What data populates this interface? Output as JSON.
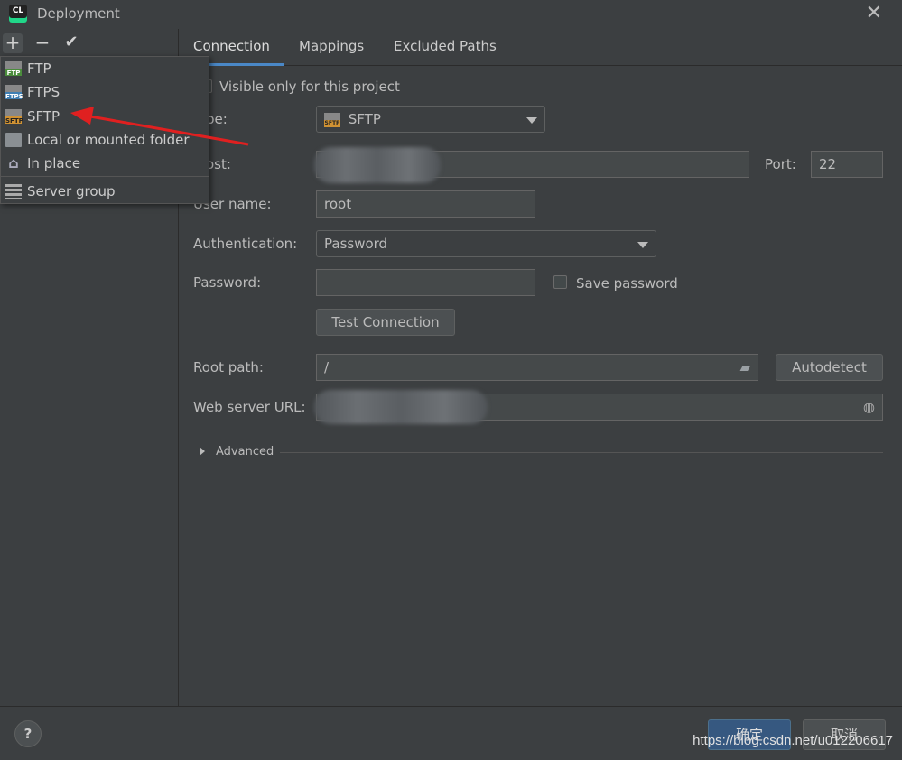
{
  "window": {
    "title": "Deployment",
    "logo_text": "CL"
  },
  "left_toolbar": {
    "add": "+",
    "remove": "−",
    "apply": "✔"
  },
  "add_popup": {
    "items": [
      {
        "label": "FTP",
        "icon": "ftp-icon",
        "icon_text": "FTP"
      },
      {
        "label": "FTPS",
        "icon": "ftps-icon",
        "icon_text": "FTPS"
      },
      {
        "label": "SFTP",
        "icon": "sftp-icon",
        "icon_text": "SFTP"
      },
      {
        "label": "Local or mounted folder",
        "icon": "folder-icon",
        "icon_text": ""
      },
      {
        "label": "In place",
        "icon": "home-icon",
        "icon_text": "⌂"
      },
      {
        "label": "Server group",
        "icon": "server-group-icon",
        "icon_text": ""
      }
    ]
  },
  "tabs": [
    {
      "label": "Connection",
      "active": true
    },
    {
      "label": "Mappings",
      "active": false
    },
    {
      "label": "Excluded Paths",
      "active": false
    }
  ],
  "form": {
    "visible_only_label": "Visible only for this project",
    "type_label": "pe:",
    "type_value": "SFTP",
    "type_icon_text": "SFTP",
    "host_label": "ost:",
    "port_label": "Port:",
    "port_value": "22",
    "username_label": "User name:",
    "username_value": "root",
    "auth_label": "Authentication:",
    "auth_value": "Password",
    "password_label": "Password:",
    "password_value": "",
    "save_password_label": "Save password",
    "test_connection_label": "Test Connection",
    "root_path_label": "Root path:",
    "root_path_value": "/",
    "autodetect_label": "Autodetect",
    "web_url_label": "Web server URL:",
    "advanced_label": "Advanced"
  },
  "footer": {
    "help": "?",
    "ok": "确定",
    "cancel": "取消"
  },
  "watermark": "https://blog.csdn.net/u012206617",
  "colors": {
    "accent": "#4a88c7",
    "annotation_arrow": "#e02020",
    "background": "#3c3f41"
  }
}
